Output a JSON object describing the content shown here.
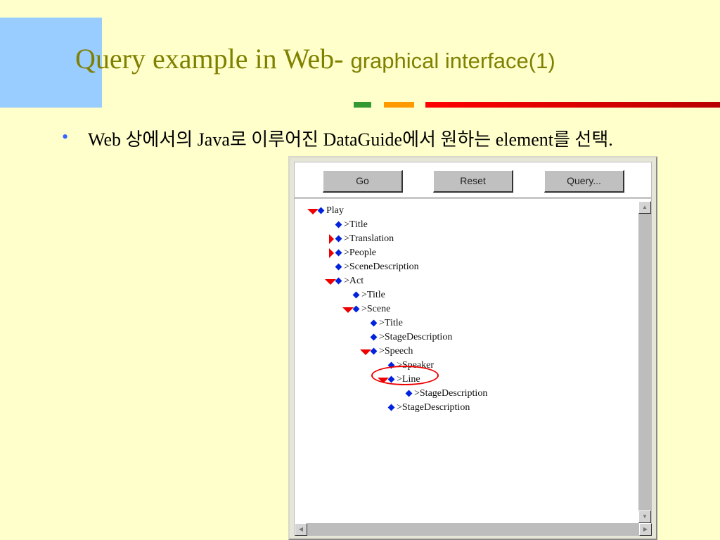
{
  "slide": {
    "title_serif": "Query example in Web- ",
    "title_sans": "graphical interface(1)",
    "bullet_text": "Web 상에서의 Java로 이루어진 DataGuide에서 원하는 element를 선택.",
    "colors": {
      "accent_green": "#339933",
      "accent_orange": "#ff9900",
      "accent_red": "#e00000"
    }
  },
  "applet": {
    "buttons": [
      "Go",
      "Reset",
      "Query..."
    ],
    "tree": [
      {
        "label": "Play",
        "level": 0,
        "state": "expanded"
      },
      {
        "label": ">Title",
        "level": 1,
        "state": "leaf"
      },
      {
        "label": ">Translation",
        "level": 1,
        "state": "collapsed"
      },
      {
        "label": ">People",
        "level": 1,
        "state": "collapsed"
      },
      {
        "label": ">SceneDescription",
        "level": 1,
        "state": "leaf"
      },
      {
        "label": ">Act",
        "level": 1,
        "state": "expanded"
      },
      {
        "label": ">Title",
        "level": 2,
        "state": "leaf"
      },
      {
        "label": ">Scene",
        "level": 2,
        "state": "expanded"
      },
      {
        "label": ">Title",
        "level": 3,
        "state": "leaf"
      },
      {
        "label": ">StageDescription",
        "level": 3,
        "state": "leaf"
      },
      {
        "label": ">Speech",
        "level": 3,
        "state": "expanded"
      },
      {
        "label": ">Speaker",
        "level": 4,
        "state": "leaf"
      },
      {
        "label": ">Line",
        "level": 4,
        "state": "expanded",
        "highlighted": true
      },
      {
        "label": ">StageDescription",
        "level": 5,
        "state": "leaf"
      },
      {
        "label": ">StageDescription",
        "level": 4,
        "state": "leaf"
      }
    ]
  }
}
